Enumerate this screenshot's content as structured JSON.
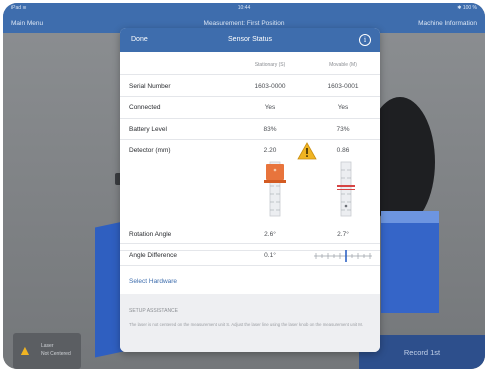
{
  "statusbar": {
    "left": "iPad ≋",
    "time": "10:44",
    "right": "✱ 100 %"
  },
  "navbar": {
    "main_menu": "Main Menu",
    "title": "Measurement: First Position",
    "machine_info": "Machine Information"
  },
  "modal": {
    "done": "Done",
    "title": "Sensor Status",
    "col_s": "Stationary (S)",
    "col_m": "Movable (M)",
    "rows": [
      {
        "label": "Serial Number",
        "s": "1603-0000",
        "m": "1603-0001"
      },
      {
        "label": "Connected",
        "s": "Yes",
        "m": "Yes"
      },
      {
        "label": "Battery Level",
        "s": "83%",
        "m": "73%"
      },
      {
        "label": "Detector (mm)",
        "s": "2.20",
        "m": "0.86"
      },
      {
        "label": "Rotation Angle",
        "s": "2.6°",
        "m": "2.7°"
      },
      {
        "label": "Angle Difference",
        "s": "0.1°",
        "m": ""
      }
    ],
    "select_hardware": "Select Hardware",
    "setup_title": "SETUP ASSISTANCE",
    "setup_body": "The laser is not centered on the measurement unit S. Adjust the laser line using the laser knob on the measurement unit M.",
    "detector_level": {
      "s": 0.25,
      "m": 0.45
    },
    "angle_diff_marker": 0.55
  },
  "warn_button": {
    "line1": "Laser",
    "line2": "Not Centered"
  },
  "record_button": "Record 1st",
  "colors": {
    "accent": "#3e6dad",
    "warning": "#f0b422",
    "detector_s": "#e8743c",
    "detector_m": "#d64545"
  }
}
